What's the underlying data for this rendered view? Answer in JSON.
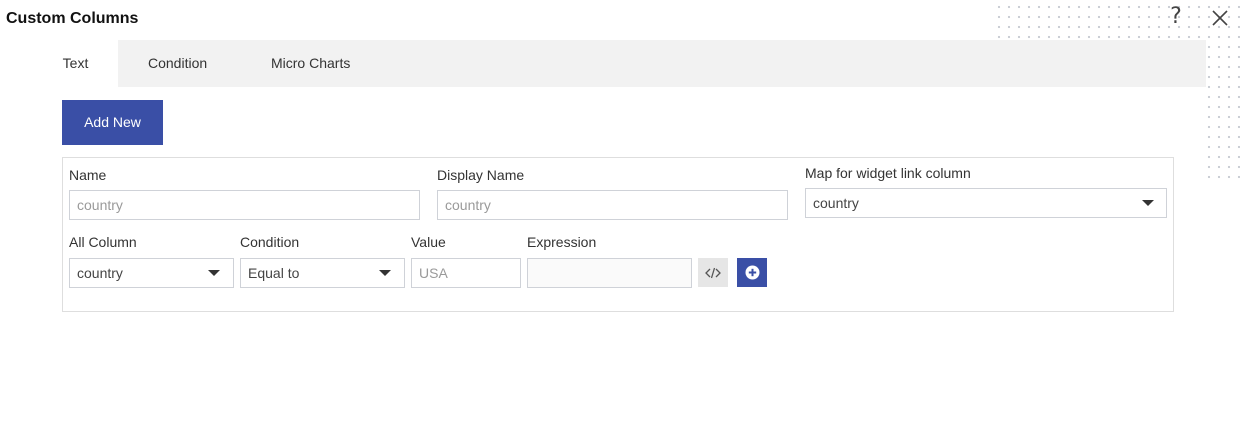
{
  "dialog": {
    "title": "Custom Columns",
    "help_icon": "?",
    "close_icon": "close-x"
  },
  "tabs": [
    {
      "label": "Text",
      "active": true
    },
    {
      "label": "Condition",
      "active": false
    },
    {
      "label": "Micro Charts",
      "active": false
    }
  ],
  "actions": {
    "add_new_label": "Add New"
  },
  "form": {
    "name": {
      "label": "Name",
      "placeholder": "country"
    },
    "display_name": {
      "label": "Display Name",
      "placeholder": "country"
    },
    "map_widget_link": {
      "label": "Map for widget link column",
      "value": "country"
    },
    "all_column": {
      "label": "All Column",
      "value": "country"
    },
    "condition": {
      "label": "Condition",
      "value": "Equal to"
    },
    "value": {
      "label": "Value",
      "placeholder": "USA"
    },
    "expression": {
      "label": "Expression",
      "value": ""
    }
  },
  "icons": {
    "expression_editor": "code-brackets",
    "add_condition": "plus-circle"
  },
  "colors": {
    "accent": "#3a4fa6",
    "tab_bar_bg": "#f2f2f2",
    "code_button_bg": "#e6e6e6"
  }
}
